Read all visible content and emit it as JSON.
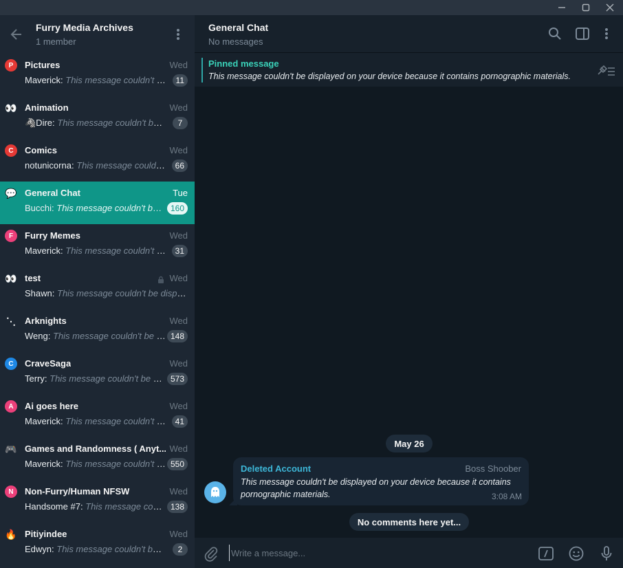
{
  "window": {
    "minimize_icon": "minimize-icon",
    "maximize_icon": "maximize-icon",
    "close_icon": "close-icon"
  },
  "sidebar": {
    "title": "Furry Media Archives",
    "subtitle": "1 member",
    "chats": [
      {
        "name": "Pictures",
        "date": "Wed",
        "sender": "Maverick:",
        "preview": "This message couldn't be displayed on your device because it contains pornographic materials.",
        "count": "11",
        "avatar_letter": "P",
        "avatar_color": "#e53935"
      },
      {
        "name": "Animation",
        "date": "Wed",
        "sender": "🦓Dire:",
        "preview": "This message couldn't be displayed on your device because it contains pornographic materials.",
        "count": "7",
        "avatar_letter": "👀",
        "avatar_color": "transparent"
      },
      {
        "name": "Comics",
        "date": "Wed",
        "sender": "notunicorna:",
        "preview": "This message couldn't be displayed on your device because it contains pornographic materials.",
        "count": "66",
        "avatar_letter": "C",
        "avatar_color": "#e53935"
      },
      {
        "name": "General Chat",
        "date": "Tue",
        "sender": "Bucchi:",
        "preview": "This message couldn't be displayed on your device because it contains pornographic materials.",
        "count": "160",
        "avatar_letter": "💬",
        "avatar_color": "transparent"
      },
      {
        "name": "Furry Memes",
        "date": "Wed",
        "sender": "Maverick:",
        "preview": "This message couldn't be displayed on your device because it contains pornographic materials.",
        "count": "31",
        "avatar_letter": "F",
        "avatar_color": "#ec407a"
      },
      {
        "name": "test",
        "date": "Wed",
        "sender": "Shawn:",
        "preview": "This message couldn't be displayed on your device because it contains pornographic materials.",
        "count": "",
        "avatar_letter": "👀",
        "avatar_color": "transparent"
      },
      {
        "name": "Arknights",
        "date": "Wed",
        "sender": "Weng:",
        "preview": "This message couldn't be displayed on your device because it contains pornographic materials.",
        "count": "148",
        "avatar_letter": "⋱",
        "avatar_color": "transparent"
      },
      {
        "name": "CraveSaga",
        "date": "Wed",
        "sender": "Terry:",
        "preview": "This message couldn't be displayed on your device because it contains pornographic materials.",
        "count": "573",
        "avatar_letter": "C",
        "avatar_color": "#1e88e5"
      },
      {
        "name": "Ai goes here",
        "date": "Wed",
        "sender": "Maverick:",
        "preview": "This message couldn't be displayed on your device because it contains pornographic materials.",
        "count": "41",
        "avatar_letter": "A",
        "avatar_color": "#ec407a"
      },
      {
        "name": "Games and Randomness ( Anyt...",
        "date": "Wed",
        "sender": "Maverick:",
        "preview": "This message couldn't be displayed on your device because it contains pornographic materials.",
        "count": "550",
        "avatar_letter": "🎮",
        "avatar_color": "transparent"
      },
      {
        "name": "Non-Furry/Human NFSW",
        "date": "Wed",
        "sender": "Handsome #7:",
        "preview": "This message couldn't be displayed on your device because it contains pornographic materials.",
        "count": "138",
        "avatar_letter": "N",
        "avatar_color": "#ec407a"
      },
      {
        "name": "Pitiyindee",
        "date": "Wed",
        "sender": "Edwyn:",
        "preview": "This message couldn't be displayed on your device because it contains pornographic materials.",
        "count": "2",
        "avatar_letter": "🔥",
        "avatar_color": "transparent"
      }
    ]
  },
  "header": {
    "title": "General Chat",
    "subtitle": "No messages"
  },
  "pinned": {
    "title": "Pinned message",
    "text": "This message couldn't be displayed on your device because it contains pornographic materials."
  },
  "messages": {
    "date": "May 26",
    "sender": "Deleted Account",
    "role": "Boss Shoober",
    "text": "This message couldn't be displayed on your device because it contains pornographic materials.",
    "time": "3:08 AM",
    "empty_notice": "No comments here yet..."
  },
  "composer": {
    "placeholder": "Write a message..."
  },
  "colors": {
    "accent": "#0f9688",
    "sidebar_bg": "#1d2733",
    "chat_bg": "#101921",
    "link": "#3db7d8"
  }
}
